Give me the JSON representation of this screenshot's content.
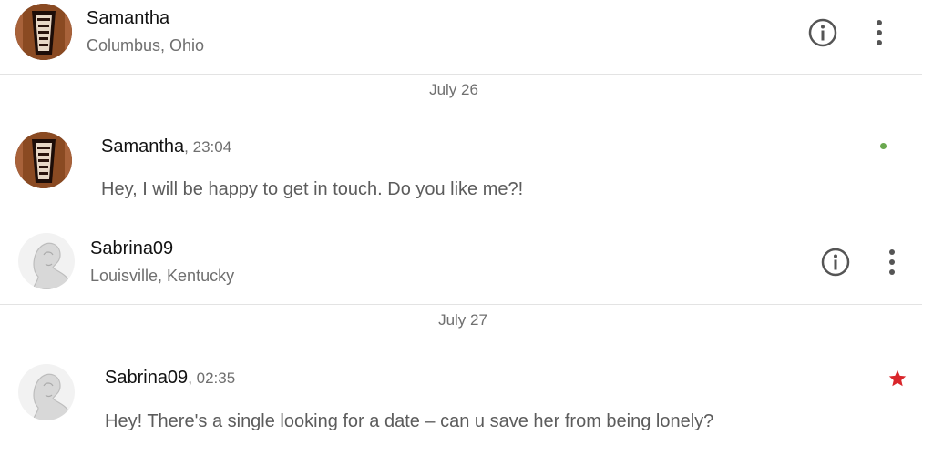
{
  "threads": [
    {
      "header": {
        "name": "Samantha",
        "location": "Columbus, Ohio"
      },
      "date": "July 26",
      "message": {
        "sender": "Samantha",
        "time": ", 23:04",
        "text": "Hey, I will be happy to get in touch. Do you like me?!"
      },
      "indicator": {
        "type": "green-dot",
        "color": "#6aa84f"
      }
    },
    {
      "header": {
        "name": "Sabrina09",
        "location": "Louisville, Kentucky"
      },
      "date": "July 27",
      "message": {
        "sender": "Sabrina09",
        "time": ", 02:35",
        "text": "Hey! There's a single looking for a date – can u save her from being lonely?"
      },
      "indicator": {
        "type": "star-icon",
        "color": "#d9262b"
      }
    }
  ],
  "icons": {
    "info": "info-icon",
    "more": "more-vertical-icon"
  }
}
